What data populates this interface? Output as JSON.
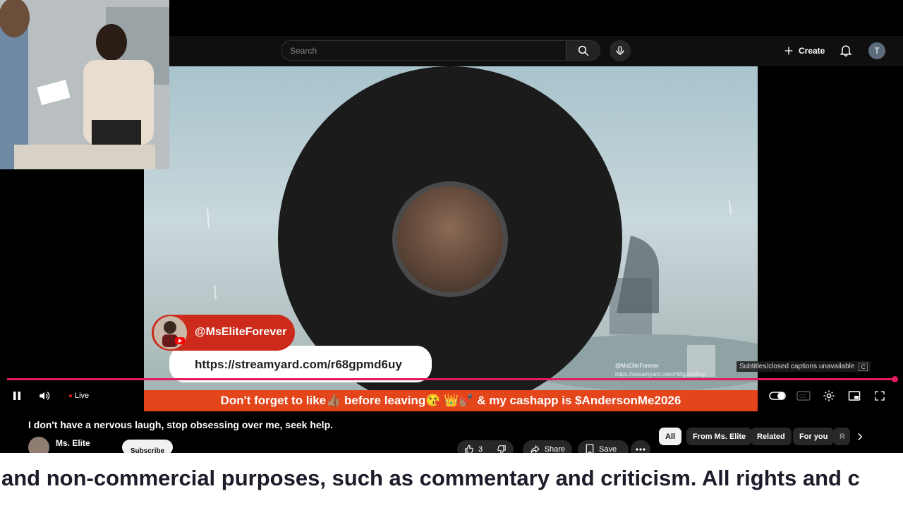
{
  "header": {
    "search_placeholder": "Search",
    "create_label": "Create",
    "avatar_letter": "T"
  },
  "video": {
    "handle": "@MsEliteForever",
    "link": "https://streamyard.com/r68gpmd6uy",
    "mini_handle": "@MsEliteForever",
    "mini_link": "https://streamyard.com/r68gpmd6uy",
    "banner": "Don't forget to like👍🏽 before leaving😘 👑💅🏽 & my cashapp is $AndersonMe2026"
  },
  "player": {
    "live_label": "Live",
    "cc_tooltip": "Subtitles/closed captions unavailable",
    "cc_key": "C",
    "progress_fraction": 1.0,
    "accent_color": "#e41b5c"
  },
  "meta": {
    "title": "I don't have a nervous laugh, stop obsessing over me, seek help.",
    "channel_name": "Ms. Elite",
    "subscribe_label": "Subscribe",
    "like_count": "3",
    "share_label": "Share",
    "save_label": "Save"
  },
  "chips": [
    "All",
    "From Ms. Elite",
    "Related",
    "For you",
    "R"
  ],
  "caption_text": "and non-commercial purposes, such as commentary and criticism. All rights and c",
  "icons": [
    "search-icon",
    "mic-icon",
    "plus-icon",
    "bell-icon",
    "pause-icon",
    "volume-icon",
    "toggle-icon",
    "cc-icon",
    "gear-icon",
    "miniplayer-icon",
    "fullscreen-icon",
    "like-icon",
    "dislike-icon",
    "share-icon",
    "save-icon",
    "more-icon",
    "chevron-right-icon"
  ]
}
